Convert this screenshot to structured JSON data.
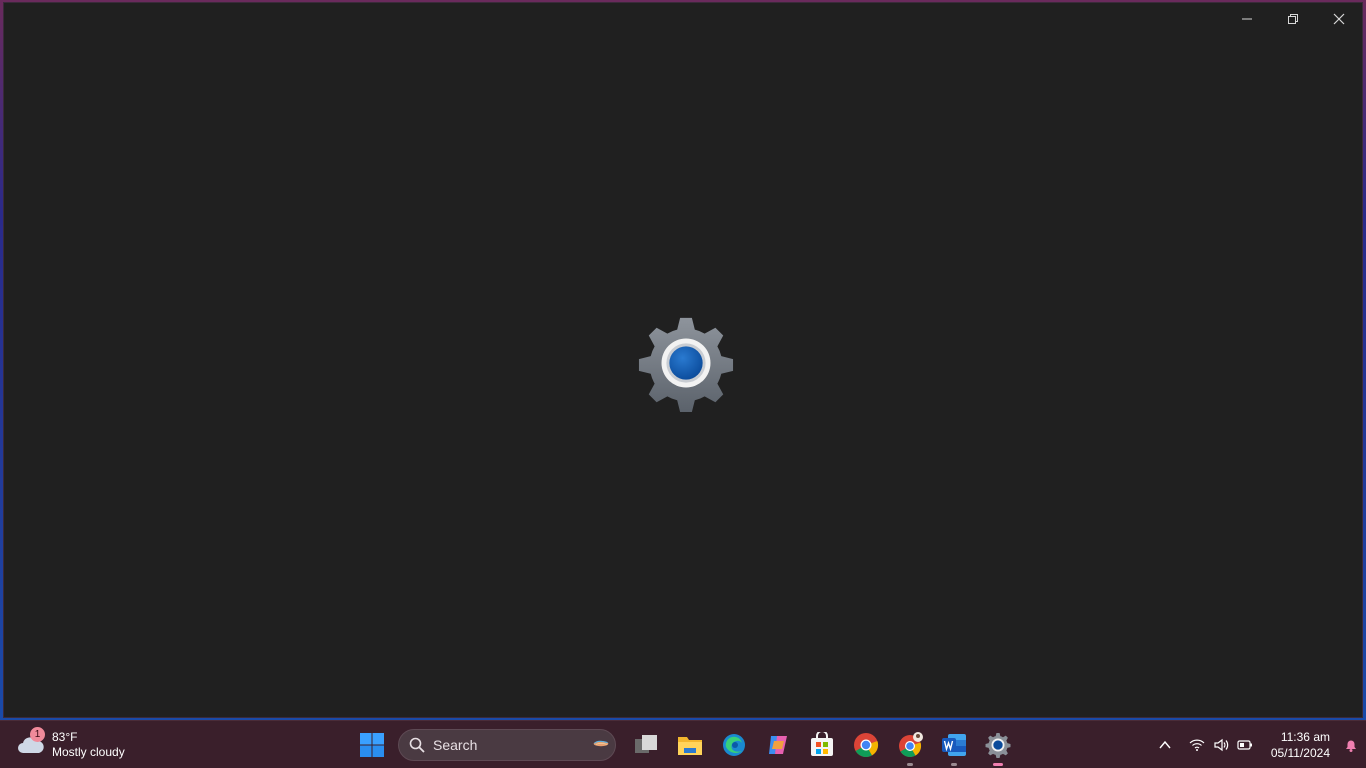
{
  "window": {
    "controls": {
      "minimize": "minimize-icon",
      "restore": "restore-icon",
      "close": "close-icon"
    },
    "splash_icon": "settings-gear-icon"
  },
  "taskbar": {
    "weather": {
      "temperature": "83°F",
      "condition": "Mostly cloudy",
      "badge": "1"
    },
    "search": {
      "placeholder": "Search"
    },
    "apps": [
      {
        "name": "start-button",
        "icon": "windows-logo-icon"
      },
      {
        "name": "task-view",
        "icon": "task-view-icon"
      },
      {
        "name": "file-explorer",
        "icon": "folder-icon"
      },
      {
        "name": "edge",
        "icon": "edge-icon"
      },
      {
        "name": "copilot",
        "icon": "copilot-icon"
      },
      {
        "name": "store",
        "icon": "store-icon"
      },
      {
        "name": "chrome",
        "icon": "chrome-icon"
      },
      {
        "name": "chrome-profile",
        "icon": "chrome-profile-icon"
      },
      {
        "name": "word",
        "icon": "word-icon"
      },
      {
        "name": "settings",
        "icon": "settings-gear-icon"
      }
    ],
    "tray": {
      "time": "11:36 am",
      "date": "05/11/2024"
    },
    "colors": {
      "accent": "#f07fb0",
      "taskbar_bg": "#3a1f2b",
      "window_bg": "#202020"
    }
  }
}
